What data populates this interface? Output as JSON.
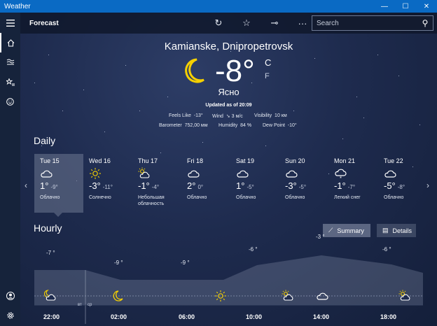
{
  "window": {
    "title": "Weather",
    "min": "—",
    "max": "☐",
    "close": "✕"
  },
  "nav": {
    "menu_icon": "hamburger-icon",
    "items": [
      "home-icon",
      "maps-icon",
      "favorites-icon",
      "smiley-icon"
    ],
    "bottom": [
      "account-icon",
      "settings-icon"
    ]
  },
  "cmdbar": {
    "title": "Forecast",
    "search_placeholder": "Search"
  },
  "current": {
    "location": "Kamianske, Dnipropetrovsk",
    "temp": "-8",
    "degree": "°",
    "unit_c": "C",
    "unit_f": "F",
    "condition": "Ясно",
    "updated": "Updated as of 20:09",
    "feels_like_label": "Feels Like",
    "feels_like": "-13°",
    "wind_label": "Wind",
    "wind": "3 м/с",
    "visibility_label": "Visibility",
    "visibility": "10 км",
    "barometer_label": "Barometer",
    "barometer": "752,00 мм",
    "humidity_label": "Humidity",
    "humidity": "84 %",
    "dewpoint_label": "Dew Point",
    "dewpoint": "-10°"
  },
  "daily": {
    "title": "Daily",
    "days": [
      {
        "name": "Tue 15",
        "icon": "cloudy-icon",
        "hi": "1°",
        "lo": "-9°",
        "cond": "Облачно"
      },
      {
        "name": "Wed 16",
        "icon": "sun-icon",
        "hi": "-3°",
        "lo": "-11°",
        "cond": "Солнечно"
      },
      {
        "name": "Thu 17",
        "icon": "partly-sunny-icon",
        "hi": "-1°",
        "lo": "-4°",
        "cond": "Небольшая облачность"
      },
      {
        "name": "Fri 18",
        "icon": "cloudy-icon",
        "hi": "2°",
        "lo": "0°",
        "cond": "Облачно"
      },
      {
        "name": "Sat 19",
        "icon": "cloudy-icon",
        "hi": "1°",
        "lo": "-5°",
        "cond": "Облачно"
      },
      {
        "name": "Sun 20",
        "icon": "cloudy-icon",
        "hi": "-3°",
        "lo": "-5°",
        "cond": "Облачно"
      },
      {
        "name": "Mon 21",
        "icon": "light-snow-icon",
        "hi": "-1°",
        "lo": "-7°",
        "cond": "Легкий снег"
      },
      {
        "name": "Tue 22",
        "icon": "cloudy-icon",
        "hi": "-5°",
        "lo": "-8°",
        "cond": "Облачно"
      }
    ]
  },
  "hourly": {
    "title": "Hourly",
    "summary_label": "Summary",
    "details_label": "Details",
    "temps": [
      {
        "label": "-7 °"
      },
      {
        "label": "-9 °"
      },
      {
        "label": "-9 °"
      },
      {
        "label": "-6 °"
      },
      {
        "label": "-3 °"
      },
      {
        "label": "-6 °"
      }
    ],
    "times": [
      "22:00",
      "02:00",
      "06:00",
      "10:00",
      "14:00",
      "18:00"
    ],
    "day_sep_left": "вт",
    "day_sep_right": "ср",
    "icons": [
      "partly-cloudy-night-icon",
      "moon-icon",
      "sun-icon",
      "partly-sunny-icon",
      "cloudy-icon",
      "partly-sunny-icon"
    ]
  }
}
